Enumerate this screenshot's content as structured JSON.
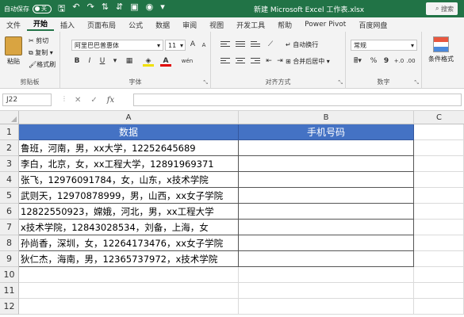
{
  "title_bar": {
    "autosave_label": "自动保存",
    "autosave_state": "关",
    "title": "新建 Microsoft Excel 工作表.xlsx",
    "search_label": "搜索"
  },
  "menu": [
    "文件",
    "开始",
    "插入",
    "页面布局",
    "公式",
    "数据",
    "审阅",
    "视图",
    "开发工具",
    "帮助",
    "Power Pivot",
    "百度网盘"
  ],
  "ribbon": {
    "clipboard": {
      "paste": "粘贴",
      "cut": "剪切",
      "copy": "复制",
      "format_painter": "格式刷",
      "label": "剪贴板"
    },
    "font": {
      "name": "阿里巴巴普惠体",
      "size": "11",
      "bold": "B",
      "italic": "I",
      "underline": "U",
      "grow": "A",
      "shrink": "A",
      "font_color": "A",
      "phonetic": "wén",
      "label": "字体"
    },
    "align": {
      "wrap": "自动换行",
      "merge": "合并后居中",
      "label": "对齐方式"
    },
    "number": {
      "format": "常规",
      "percent": "%",
      "comma": "9",
      "label": "数字"
    },
    "styles": {
      "conditional": "条件格式"
    }
  },
  "formula_bar": {
    "name_box": "J22",
    "fx": "fx",
    "cancel": "✕",
    "enter": "✓",
    "content": ""
  },
  "sheet": {
    "columns": [
      "A",
      "B",
      "C"
    ],
    "rows": [
      {
        "num": "1",
        "a": "数据",
        "b": "手机号码"
      },
      {
        "num": "2",
        "a": "鲁班，河南，男，xx大学，12252645689",
        "b": ""
      },
      {
        "num": "3",
        "a": "李白，北京，女，xx工程大学，12891969371",
        "b": ""
      },
      {
        "num": "4",
        "a": "张飞，12976091784，女，山东，x技术学院",
        "b": ""
      },
      {
        "num": "5",
        "a": "武则天，12970878999，男，山西，xx女子学院",
        "b": ""
      },
      {
        "num": "6",
        "a": "12822550923，嫦娥，河北，男，xx工程大学",
        "b": ""
      },
      {
        "num": "7",
        "a": "x技术学院，12843028534，刘备，上海，女",
        "b": ""
      },
      {
        "num": "8",
        "a": "孙尚香，深圳，女，12264173476，xx女子学院",
        "b": ""
      },
      {
        "num": "9",
        "a": "狄仁杰，海南，男，12365737972，x技术学院",
        "b": ""
      },
      {
        "num": "10",
        "a": "",
        "b": ""
      },
      {
        "num": "11",
        "a": "",
        "b": ""
      },
      {
        "num": "12",
        "a": "",
        "b": ""
      }
    ]
  },
  "colors": {
    "accent": "#217346",
    "header_fill": "#4472c4"
  }
}
